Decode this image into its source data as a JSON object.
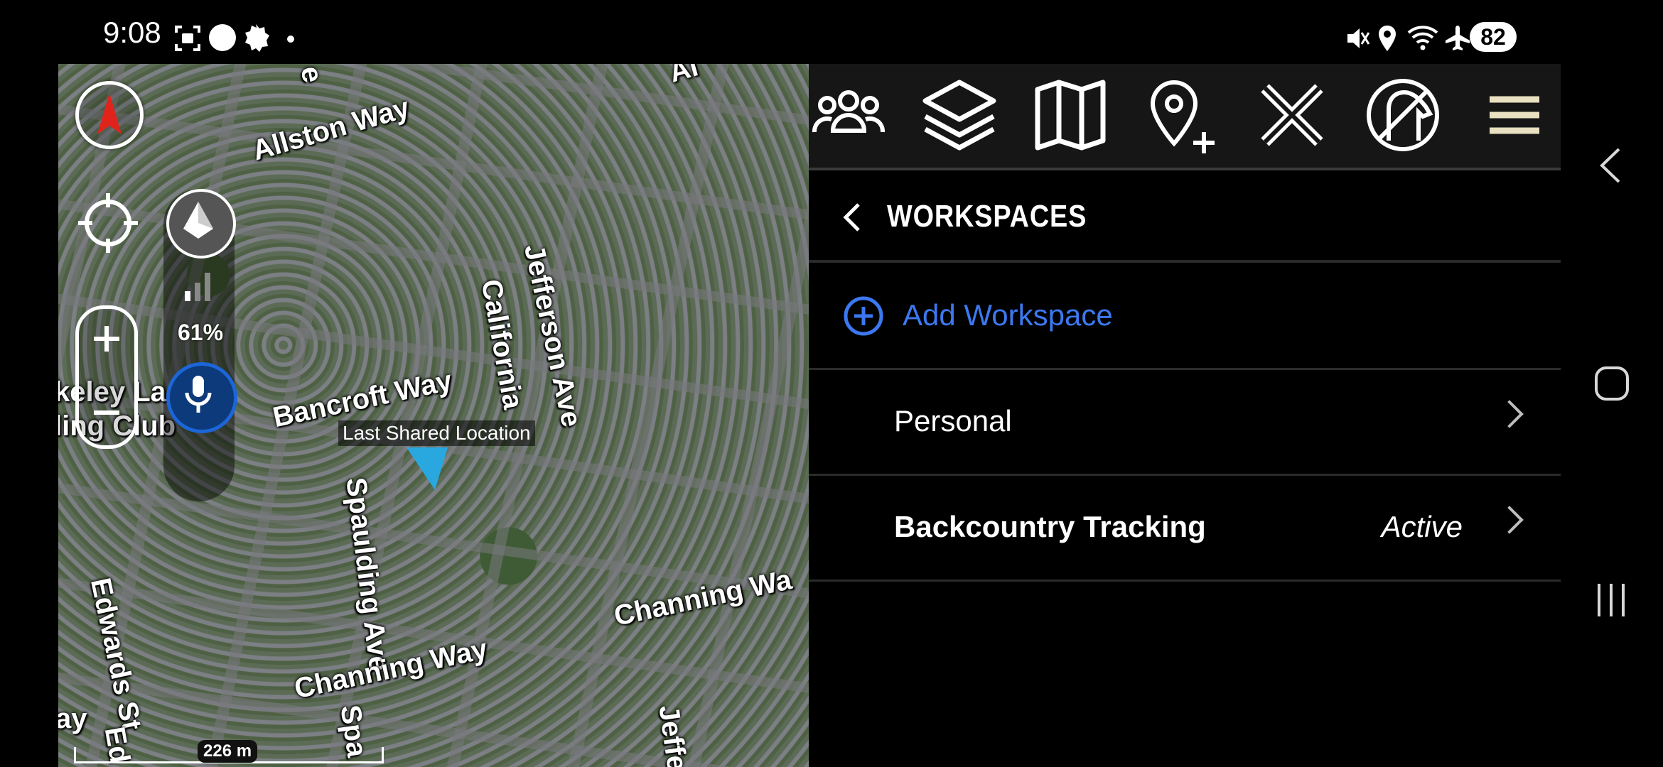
{
  "status_bar": {
    "time": "9:08",
    "battery": "82",
    "icons": [
      "screenshot-icon",
      "circle-icon",
      "notification-icon",
      "dot-icon",
      "mute-icon",
      "location-pin-icon",
      "wifi-icon",
      "airplane-icon"
    ]
  },
  "map": {
    "streets": [
      "Allston Way",
      "Jefferson Ave",
      "California",
      "Bancroft Way",
      "Spaulding Ave",
      "Edwards St",
      "Channing Way",
      "Channing Wa",
      "Jeffers",
      "keley La",
      "ling Club",
      "ay",
      "Ed",
      "Spa",
      "e",
      "Al"
    ],
    "signal_percent": "61%",
    "last_shared_location": "Last Shared Location",
    "scale": "226 m",
    "colors": {
      "marker": "#29a8e0",
      "mic_button": "#0d3a7a",
      "compass_arrow": "#e0241b"
    }
  },
  "toolbar": {
    "icons": [
      "team-icon",
      "layers-icon",
      "map-icon",
      "add-marker-icon",
      "close-icon",
      "dog-tracking-icon",
      "menu-icon"
    ]
  },
  "workspaces": {
    "title": "WORKSPACES",
    "add_label": "Add Workspace",
    "items": [
      {
        "label": "Personal",
        "status": ""
      },
      {
        "label": "Backcountry Tracking",
        "status": "Active"
      }
    ],
    "colors": {
      "accent": "#3c78f0"
    }
  },
  "nav_bar": {
    "icons": [
      "back-icon",
      "home-icon",
      "recents-icon"
    ]
  }
}
